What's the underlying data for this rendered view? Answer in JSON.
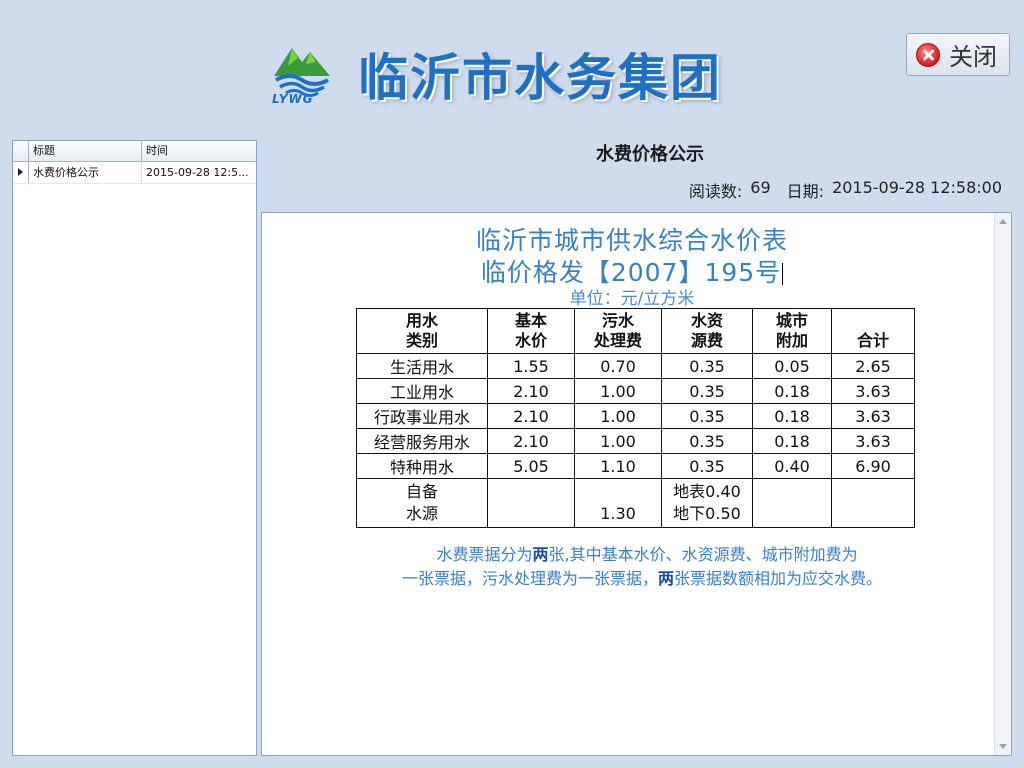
{
  "header": {
    "brand_name": "临沂市水务集团",
    "logo_text": "LYWG",
    "close_label": "关闭"
  },
  "list": {
    "columns": [
      "标题",
      "时间"
    ],
    "rows": [
      {
        "title": "水费价格公示",
        "time": "2015-09-28 12:5..."
      }
    ]
  },
  "article": {
    "title": "水费价格公示",
    "read_label": "阅读数:",
    "read_count": "69",
    "date_label": "日期:",
    "date": "2015-09-28 12:58:00"
  },
  "doc": {
    "title1": "临沂市城市供水综合水价表",
    "title2": "临价格发【2007】195号",
    "unit": "单位：元/立方米",
    "table": {
      "headers": [
        [
          "用水",
          "类别"
        ],
        [
          "基本",
          "水价"
        ],
        [
          "污水",
          "处理费"
        ],
        [
          "水资",
          "源费"
        ],
        [
          "城市",
          "附加"
        ],
        [
          "",
          "合计"
        ]
      ],
      "rows": [
        [
          "生活用水",
          "1.55",
          "0.70",
          "0.35",
          "0.05",
          "2.65"
        ],
        [
          "工业用水",
          "2.10",
          "1.00",
          "0.35",
          "0.18",
          "3.63"
        ],
        [
          "行政事业用水",
          "2.10",
          "1.00",
          "0.35",
          "0.18",
          "3.63"
        ],
        [
          "经营服务用水",
          "2.10",
          "1.00",
          "0.35",
          "0.18",
          "3.63"
        ],
        [
          "特种用水",
          "5.05",
          "1.10",
          "0.35",
          "0.40",
          "6.90"
        ]
      ],
      "self_source": {
        "label1": "自备",
        "label2": "水源",
        "sewage": "1.30",
        "surface": "地表0.40",
        "underground": "地下0.50"
      }
    },
    "note_line1_a": "水费票据分为",
    "note_line1_bold": "两",
    "note_line1_b": "张,其中基本水价、水资源费、城市附加费为",
    "note_line2_a": "一张票据，污水处理费为一张票据，",
    "note_line2_bold": "两",
    "note_line2_b": "张票据数额相加为应交水费。"
  }
}
